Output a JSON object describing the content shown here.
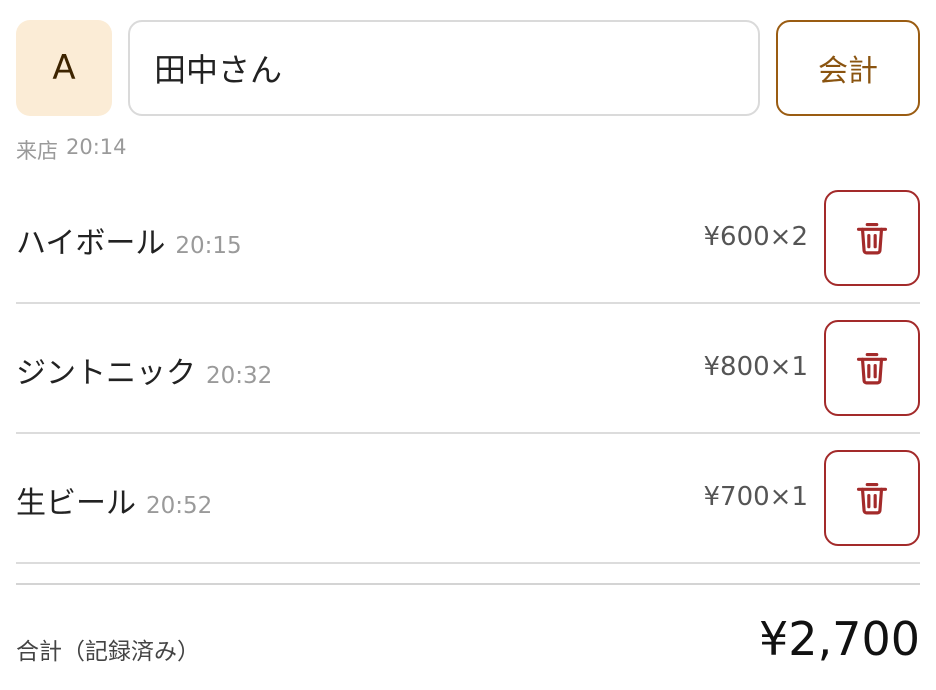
{
  "header": {
    "avatar_initial": "A",
    "name_value": "田中さん",
    "checkout_label": "会計"
  },
  "arrival": {
    "label": "来店",
    "time": "20:14"
  },
  "orders": [
    {
      "name": "ハイボール",
      "time": "20:15",
      "price": "¥600×2",
      "delete_icon": "trash-icon"
    },
    {
      "name": "ジントニック",
      "time": "20:32",
      "price": "¥800×1",
      "delete_icon": "trash-icon"
    },
    {
      "name": "生ビール",
      "time": "20:52",
      "price": "¥700×1",
      "delete_icon": "trash-icon"
    }
  ],
  "total": {
    "label": "合計（記録済み）",
    "amount": "¥2,700"
  },
  "colors": {
    "avatar_bg": "#fbecd6",
    "checkout_accent": "#9a5c12",
    "delete_accent": "#a32a2a"
  }
}
